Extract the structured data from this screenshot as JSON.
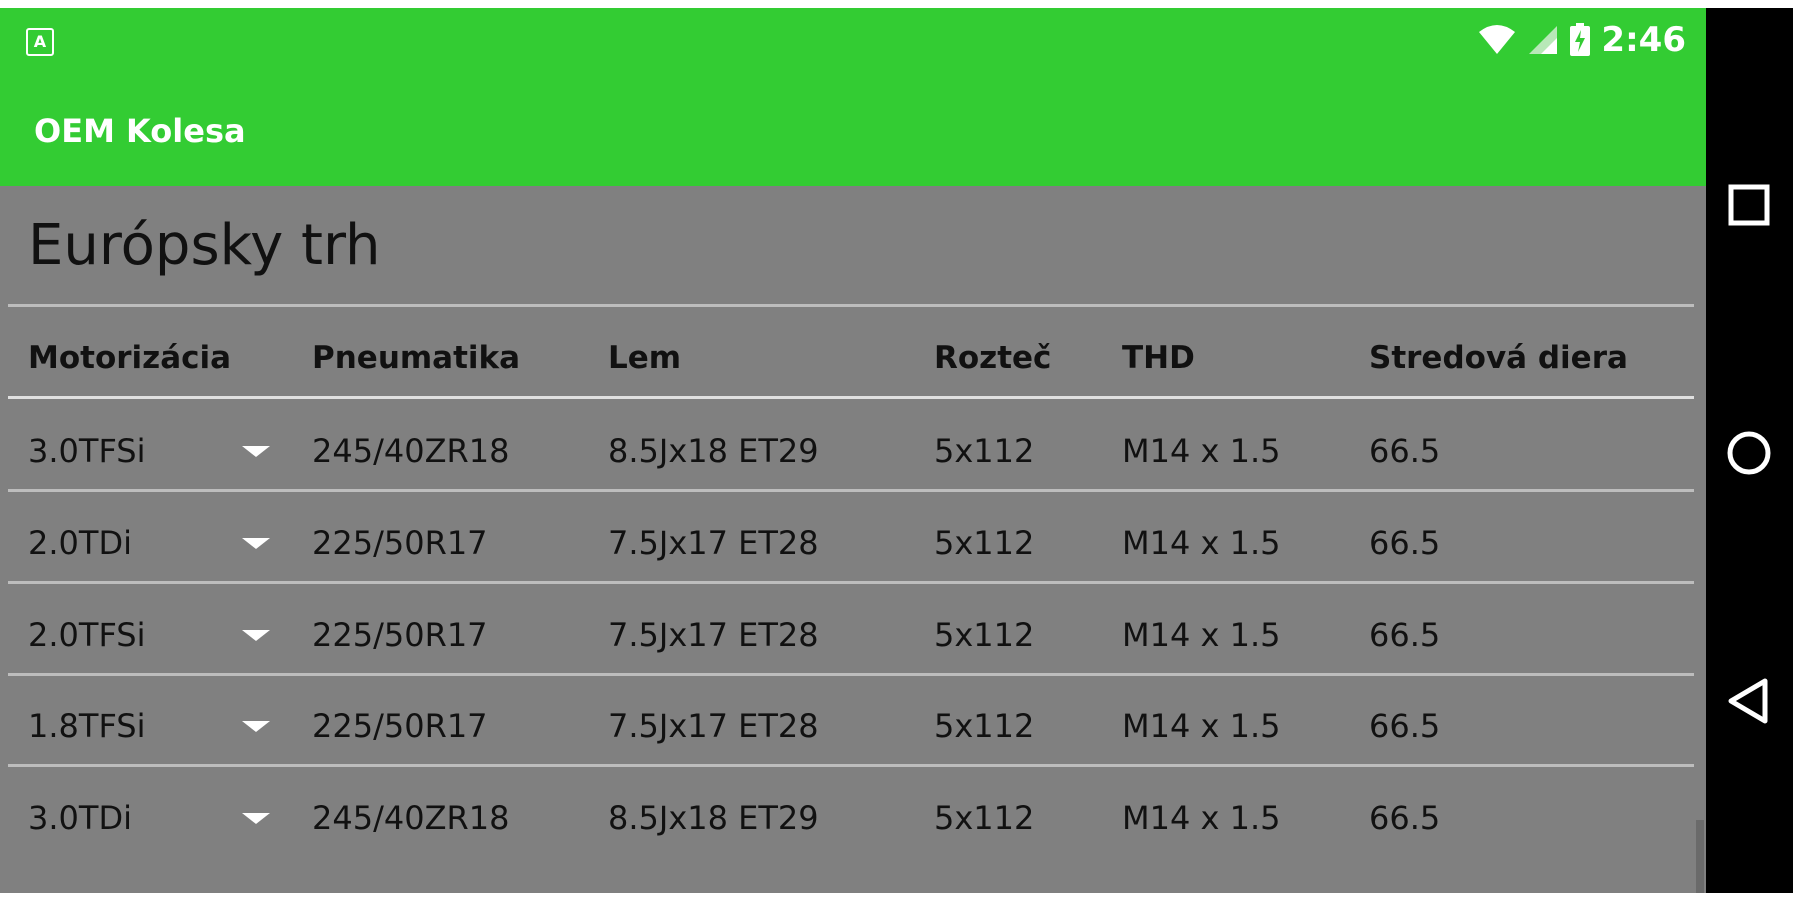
{
  "status_bar": {
    "notification_icon": "android-notification-icon",
    "time": "2:46",
    "icons": [
      "wifi-icon",
      "signal-icon",
      "battery-charging-icon"
    ]
  },
  "app_bar": {
    "title": "OEM Kolesa"
  },
  "main": {
    "heading": "Európsky trh",
    "table": {
      "headers": [
        "Motorizácia",
        "Pneumatika",
        "Lem",
        "Rozteč",
        "THD",
        "Stredová diera"
      ],
      "rows": [
        [
          "3.0TFSi",
          "245/40ZR18",
          "8.5Jx18 ET29",
          "5x112",
          "M14 x 1.5",
          "66.5"
        ],
        [
          "2.0TDi",
          "225/50R17",
          "7.5Jx17 ET28",
          "5x112",
          "M14 x 1.5",
          "66.5"
        ],
        [
          "2.0TFSi",
          "225/50R17",
          "7.5Jx17 ET28",
          "5x112",
          "M14 x 1.5",
          "66.5"
        ],
        [
          "1.8TFSi",
          "225/50R17",
          "7.5Jx17 ET28",
          "5x112",
          "M14 x 1.5",
          "66.5"
        ],
        [
          "3.0TDi",
          "245/40ZR18",
          "8.5Jx18 ET29",
          "5x112",
          "M14 x 1.5",
          "66.5"
        ]
      ]
    }
  },
  "nav_bar": {
    "buttons": [
      "recents-square-icon",
      "home-circle-icon",
      "back-triangle-icon"
    ]
  },
  "colors": {
    "app_bar": "#33cc33",
    "content_bg": "#808080",
    "nav_bar": "#000000"
  }
}
